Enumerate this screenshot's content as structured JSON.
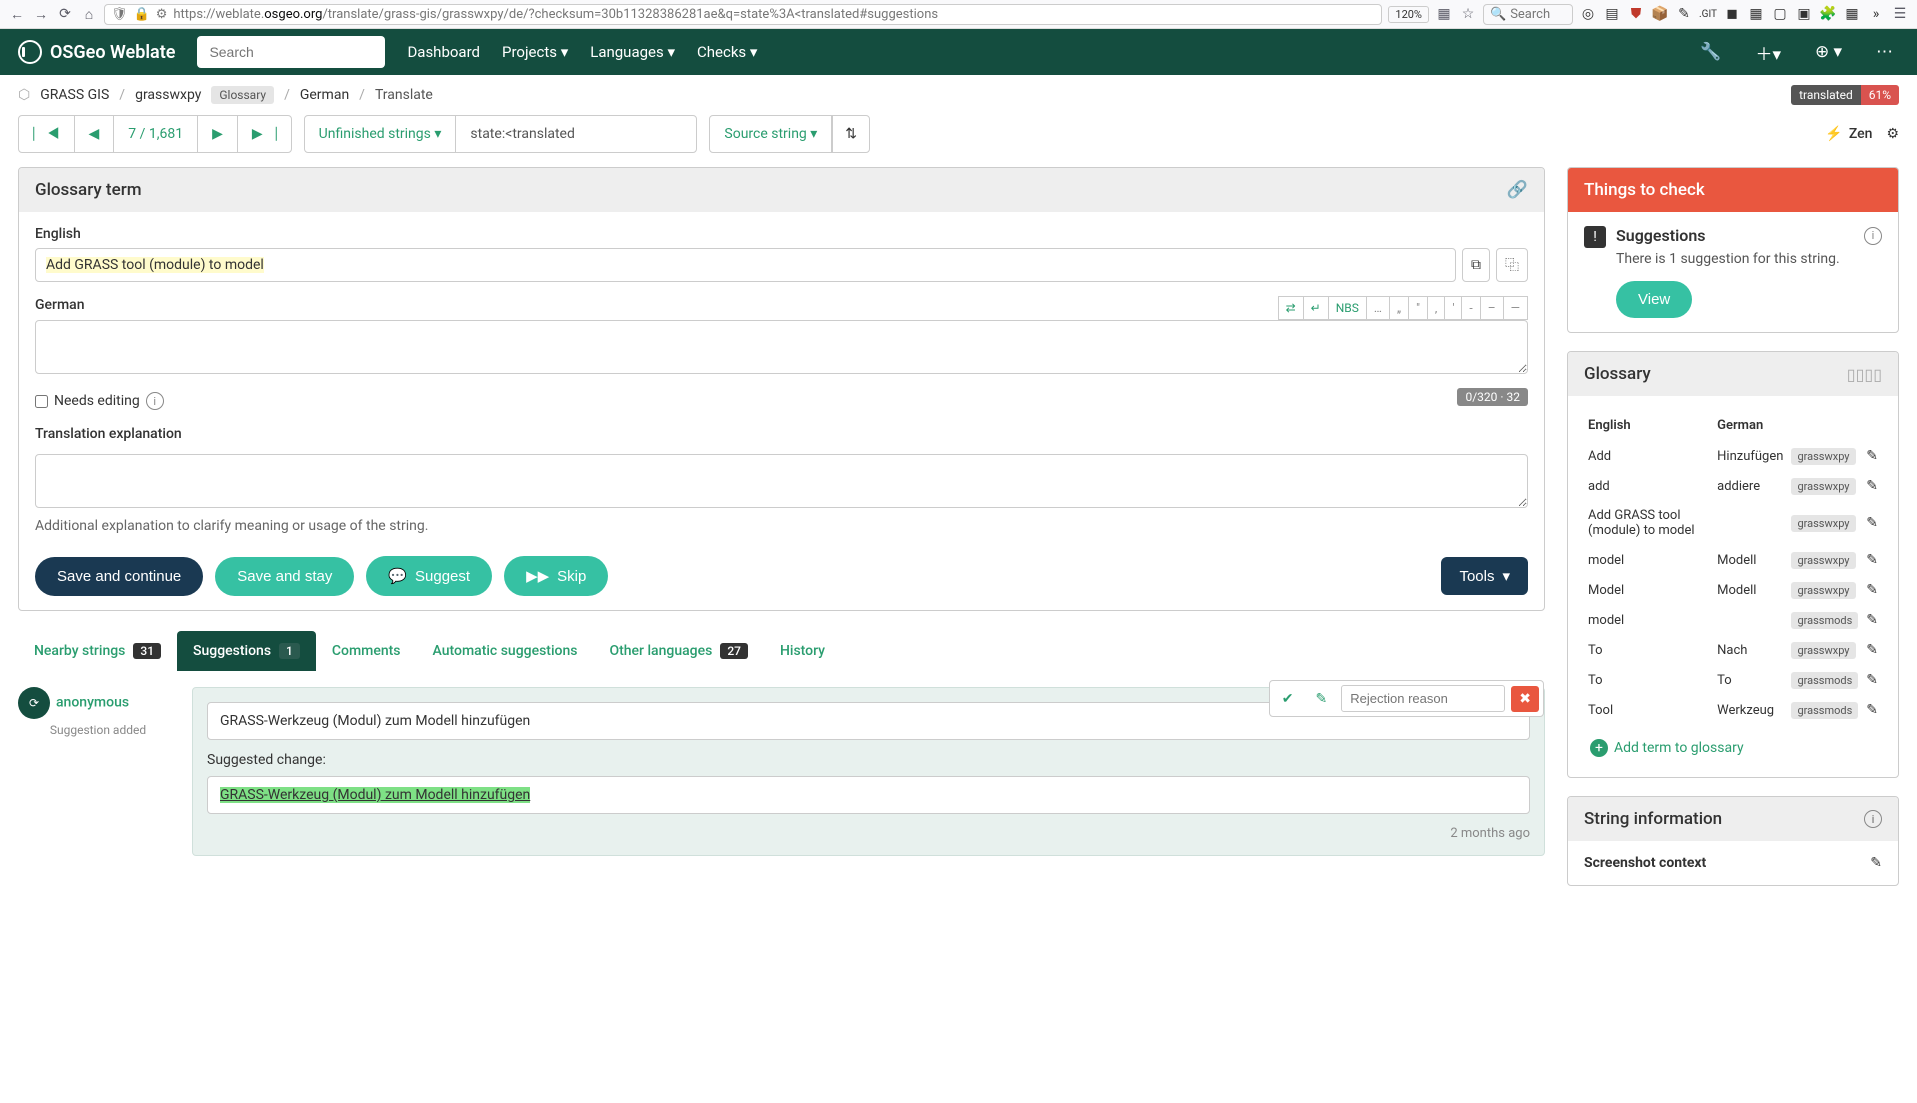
{
  "browser": {
    "url_prefix": "https://weblate.",
    "url_domain": "osgeo.org",
    "url_path": "/translate/grass-gis/grasswxpy/de/?checksum=30b11328386281ae&q=state%3A<translated#suggestions",
    "zoom": "120%",
    "search_placeholder": "Search"
  },
  "nav": {
    "brand": "OSGeo Weblate",
    "search_placeholder": "Search",
    "dashboard": "Dashboard",
    "projects": "Projects",
    "languages": "Languages",
    "checks": "Checks"
  },
  "breadcrumb": {
    "project": "GRASS GIS",
    "component": "grasswxpy",
    "component_badge": "Glossary",
    "language": "German",
    "action": "Translate",
    "status_label": "translated",
    "status_percent": "61%"
  },
  "filter": {
    "position": "7 / 1,681",
    "mode": "Unfinished strings",
    "query": "state:<translated",
    "source": "Source string",
    "zen": "Zen"
  },
  "editor": {
    "panel_title": "Glossary term",
    "source_label": "English",
    "source_text": "Add GRASS tool (module) to model",
    "target_label": "German",
    "nbs": "NBS",
    "needs_editing": "Needs editing",
    "char_count": "0/320 · 32",
    "explanation_label": "Translation explanation",
    "explanation_help": "Additional explanation to clarify meaning or usage of the string.",
    "save_continue": "Save and continue",
    "save_stay": "Save and stay",
    "suggest": "Suggest",
    "skip": "Skip",
    "tools": "Tools"
  },
  "tabs": {
    "nearby": "Nearby strings",
    "nearby_count": "31",
    "suggestions": "Suggestions",
    "suggestions_count": "1",
    "comments": "Comments",
    "auto": "Automatic suggestions",
    "other": "Other languages",
    "other_count": "27",
    "history": "History"
  },
  "suggestion": {
    "user": "anonymous",
    "user_sub": "Suggestion added",
    "current": "GRASS-Werkzeug (Modul) zum Modell hinzufügen",
    "change_label": "Suggested change:",
    "change_text": "GRASS-Werkzeug (Modul) zum Modell hinzufügen",
    "rejection_placeholder": "Rejection reason",
    "time": "2 months ago"
  },
  "checks": {
    "title": "Things to check",
    "item_title": "Suggestions",
    "item_desc": "There is 1 suggestion for this string.",
    "view": "View"
  },
  "glossary": {
    "title": "Glossary",
    "col_en": "English",
    "col_de": "German",
    "rows": [
      {
        "en": "Add",
        "de": "Hinzufügen",
        "src": "grasswxpy"
      },
      {
        "en": "add",
        "de": "addiere",
        "src": "grasswxpy"
      },
      {
        "en": "Add GRASS tool (module) to model",
        "de": "",
        "src": "grasswxpy"
      },
      {
        "en": "model",
        "de": "Modell",
        "src": "grasswxpy"
      },
      {
        "en": "Model",
        "de": "Modell",
        "src": "grasswxpy"
      },
      {
        "en": "model",
        "de": "",
        "src": "grassmods"
      },
      {
        "en": "To",
        "de": "Nach",
        "src": "grasswxpy"
      },
      {
        "en": "To",
        "de": "To",
        "src": "grassmods"
      },
      {
        "en": "Tool",
        "de": "Werkzeug",
        "src": "grassmods"
      }
    ],
    "add_term": "Add term to glossary"
  },
  "string_info": {
    "title": "String information",
    "screenshot": "Screenshot context"
  }
}
